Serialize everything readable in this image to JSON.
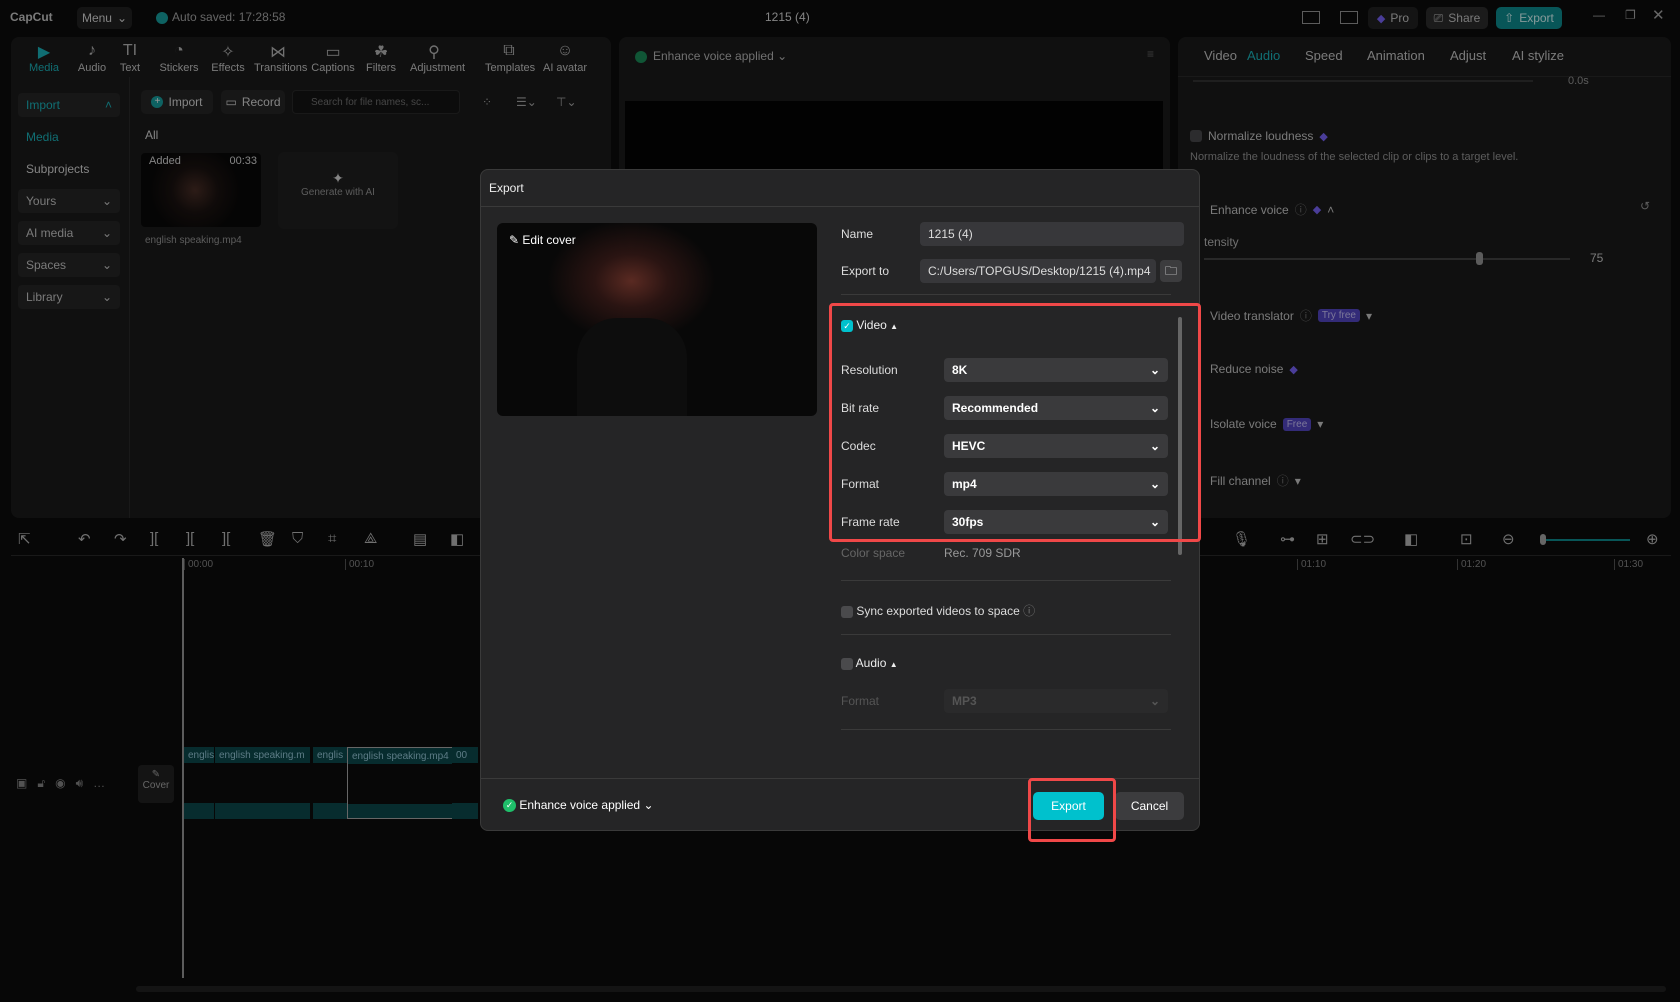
{
  "titlebar": {
    "app": "CapCut",
    "menu": "Menu",
    "autosave": "Auto saved: 17:28:58",
    "project": "1215 (4)",
    "pro": "Pro",
    "share": "Share",
    "export": "Export"
  },
  "toolbar": [
    {
      "label": "Media",
      "icon": "▶"
    },
    {
      "label": "Audio",
      "icon": "♪"
    },
    {
      "label": "Text",
      "icon": "TI"
    },
    {
      "label": "Stickers",
      "icon": "◔"
    },
    {
      "label": "Effects",
      "icon": "✧"
    },
    {
      "label": "Transitions",
      "icon": "⋈"
    },
    {
      "label": "Captions",
      "icon": "▭"
    },
    {
      "label": "Filters",
      "icon": "☘"
    },
    {
      "label": "Adjustment",
      "icon": "⚲"
    },
    {
      "label": "Templates",
      "icon": "⧉"
    },
    {
      "label": "AI avatar",
      "icon": "☺"
    }
  ],
  "sidebar": {
    "import": "Import",
    "media": "Media",
    "subprojects": "Subprojects",
    "yours": "Yours",
    "ai_media": "AI media",
    "spaces": "Spaces",
    "library": "Library"
  },
  "media": {
    "import_btn": "Import",
    "record_btn": "Record",
    "search_placeholder": "Search for file names, sc...",
    "filter_all": "All",
    "clip_badge": "Added",
    "clip_duration": "00:33",
    "clip_name": "english speaking.mp4",
    "generate": "Generate with AI"
  },
  "player": {
    "status": "Enhance voice applied"
  },
  "right": {
    "tabs": [
      "Video",
      "Audio",
      "Speed",
      "Animation",
      "Adjust",
      "AI stylize"
    ],
    "time_value": "0.0s",
    "normalize": "Normalize loudness",
    "normalize_desc": "Normalize the loudness of the selected clip or clips to a target level.",
    "enhance": "Enhance voice",
    "intensity": "tensity",
    "intensity_value": "75",
    "intensity_fraction": 0.75,
    "translator": "Video translator",
    "try_free": "Try free",
    "reduce": "Reduce noise",
    "isolate": "Isolate voice",
    "free": "Free",
    "fill": "Fill channel"
  },
  "timeline": {
    "ticks": [
      "00:00",
      "00:10",
      "01:10",
      "01:20",
      "01:30"
    ],
    "cover": "Cover",
    "clips": [
      "englis",
      "english speaking.m",
      "englis",
      "english speaking.mp4",
      "00"
    ]
  },
  "dialog": {
    "title": "Export",
    "edit_cover": "Edit cover",
    "name_label": "Name",
    "name_value": "1215 (4)",
    "export_to_label": "Export to",
    "export_to_value": "C:/Users/TOPGUS/Desktop/1215 (4).mp4",
    "video_label": "Video",
    "video_checked": true,
    "rows": [
      {
        "label": "Resolution",
        "value": "8K"
      },
      {
        "label": "Bit rate",
        "value": "Recommended"
      },
      {
        "label": "Codec",
        "value": "HEVC"
      },
      {
        "label": "Format",
        "value": "mp4"
      },
      {
        "label": "Frame rate",
        "value": "30fps"
      }
    ],
    "color_space_label": "Color space",
    "color_space_value": "Rec. 709 SDR",
    "sync": "Sync exported videos to space",
    "audio_label": "Audio",
    "audio_format_label": "Format",
    "audio_format_value": "MP3",
    "footer_status": "Enhance voice applied",
    "export_btn": "Export",
    "cancel_btn": "Cancel"
  },
  "colors": {
    "accent": "#00c1cd",
    "highlight": "#f04848"
  }
}
